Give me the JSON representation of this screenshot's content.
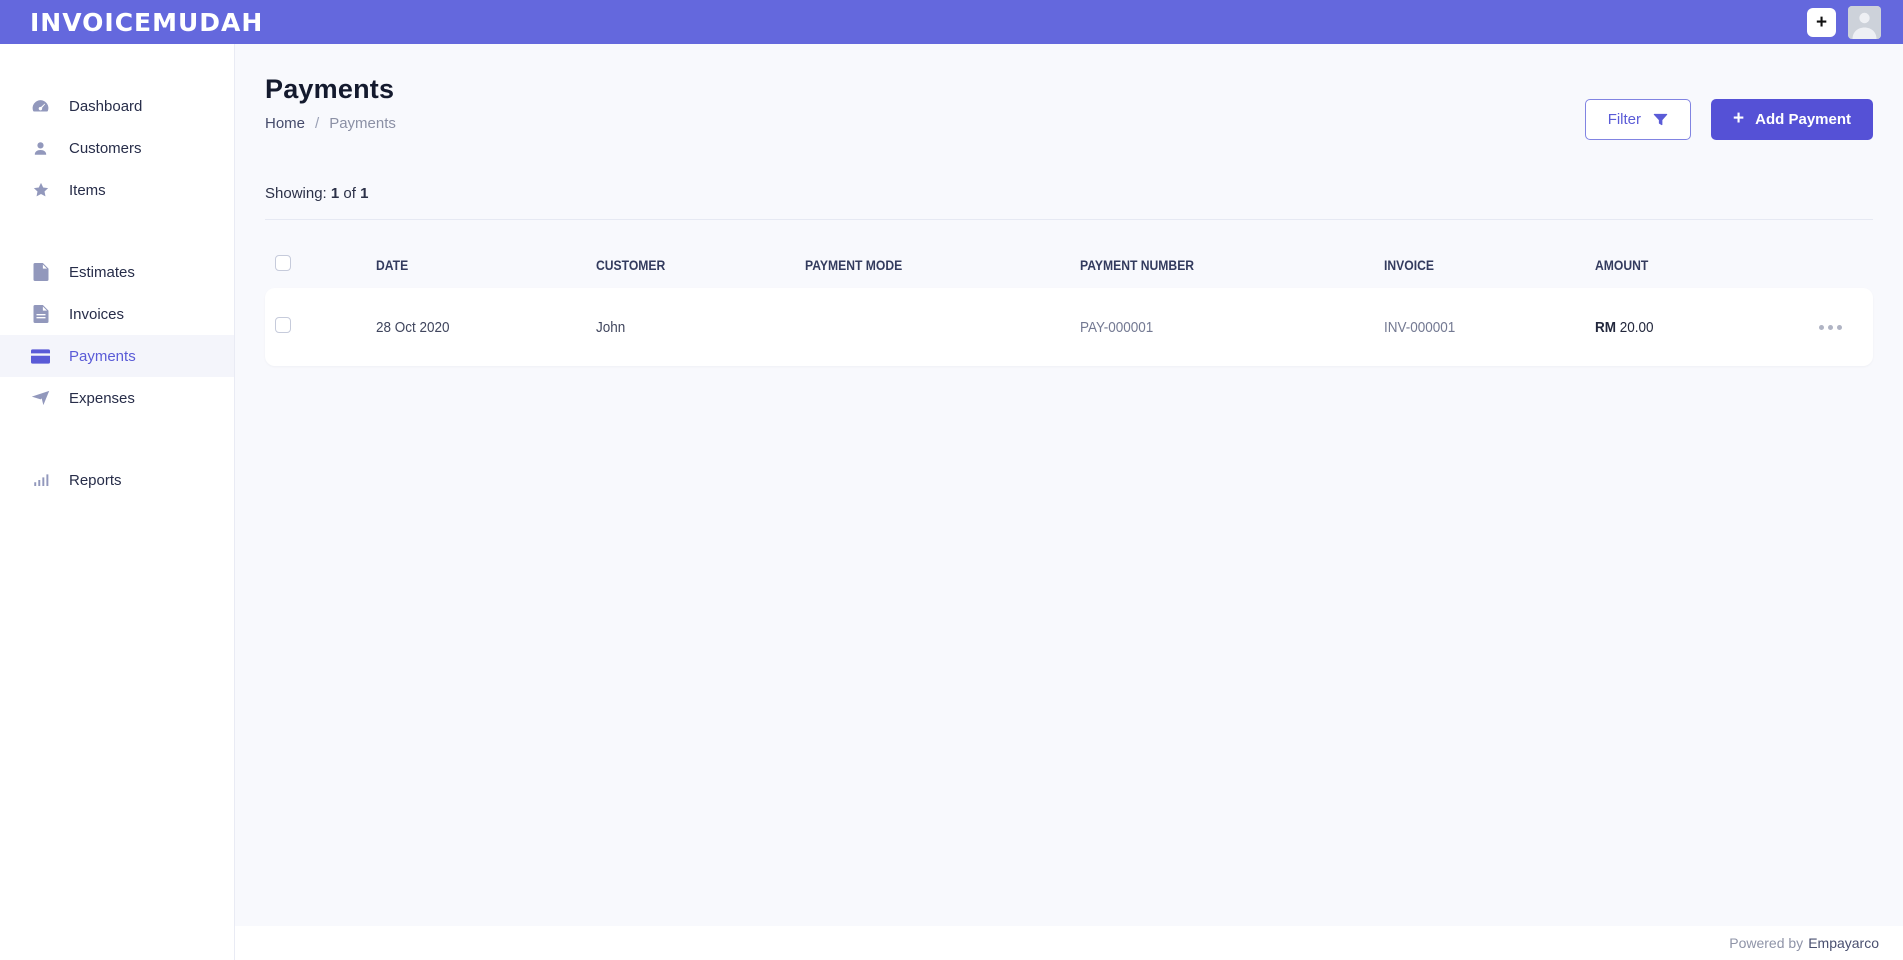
{
  "colors": {
    "topbar": "#6468dd",
    "accent": "#5551d6",
    "active_link": "#5a5bd7"
  },
  "topbar": {
    "logo": "INVOICEMUDAH",
    "new_label": "+"
  },
  "sidebar": {
    "items": [
      {
        "label": "Dashboard",
        "icon": "gauge-icon"
      },
      {
        "label": "Customers",
        "icon": "user-icon"
      },
      {
        "label": "Items",
        "icon": "star-icon"
      },
      {
        "label": "Estimates",
        "icon": "file-icon"
      },
      {
        "label": "Invoices",
        "icon": "file-lines-icon"
      },
      {
        "label": "Payments",
        "icon": "credit-card-icon",
        "active": true
      },
      {
        "label": "Expenses",
        "icon": "paper-plane-icon"
      },
      {
        "label": "Reports",
        "icon": "bar-chart-icon"
      }
    ]
  },
  "page": {
    "title": "Payments",
    "breadcrumb": {
      "home": "Home",
      "separator": "/",
      "current": "Payments"
    },
    "showing": {
      "prefix": "Showing:",
      "count": "1",
      "of": "of",
      "total": "1"
    },
    "filter_label": "Filter",
    "add_payment_label": "Add Payment",
    "add_payment_plus": "+"
  },
  "table": {
    "headers": [
      "DATE",
      "CUSTOMER",
      "PAYMENT MODE",
      "PAYMENT NUMBER",
      "INVOICE",
      "AMOUNT"
    ],
    "rows": [
      {
        "date": "28 Oct 2020",
        "customer": "John",
        "payment_mode": "",
        "payment_number": "PAY-000001",
        "invoice": "INV-000001",
        "amount_currency": "RM",
        "amount_value": "20.00"
      }
    ]
  },
  "footer": {
    "powered_by": "Powered by",
    "brand": "Empayarco"
  }
}
